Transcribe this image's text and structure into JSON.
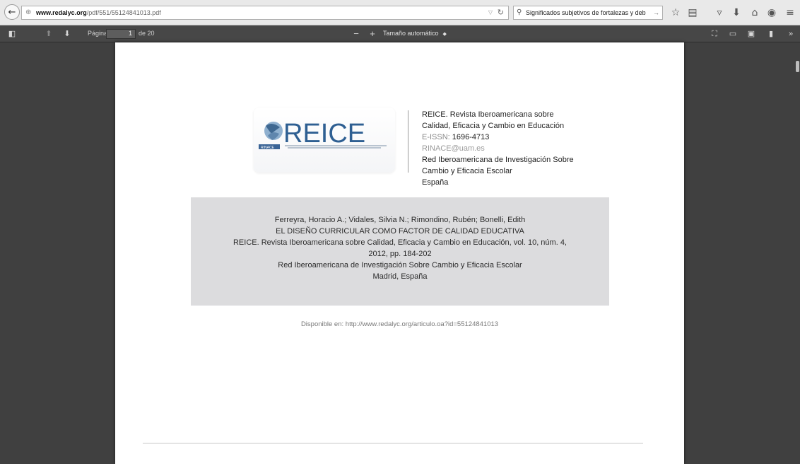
{
  "browser": {
    "url_domain": "www.redalyc.org",
    "url_path": "/pdf/551/55124841013.pdf",
    "search_query": "Significados subjetivos de fortalezas y deb"
  },
  "pdf_toolbar": {
    "page_label": "Página:",
    "page_value": "1",
    "page_count": "de 20",
    "zoom": "Tamaño automático"
  },
  "document": {
    "logo_text": "REICE",
    "logo_badge": "RINACE",
    "journal": {
      "line1": "REICE. Revista Iberoamericana sobre",
      "line2": "Calidad, Eficacia y Cambio en Educación",
      "issn_label": "E-ISSN:",
      "issn": "1696-4713",
      "email": "RINACE@uam.es",
      "org1": "Red Iberoamericana de Investigación Sobre",
      "org2": "Cambio y Eficacia Escolar",
      "country": "España"
    },
    "citation": {
      "authors": "Ferreyra, Horacio A.; Vidales, Silvia N.; Rimondino, Rubén; Bonelli, Edith",
      "title": "EL DISEÑO CURRICULAR COMO FACTOR DE CALIDAD EDUCATIVA",
      "source1": "REICE. Revista Iberoamericana sobre Calidad, Eficacia y Cambio en Educación, vol. 10, núm. 4,",
      "source2": "2012, pp. 184-202",
      "publisher": "Red Iberoamericana de Investigación Sobre Cambio y Eficacia Escolar",
      "place": "Madrid, España"
    },
    "available": "Disponible en: http://www.redalyc.org/articulo.oa?id=55124841013"
  }
}
